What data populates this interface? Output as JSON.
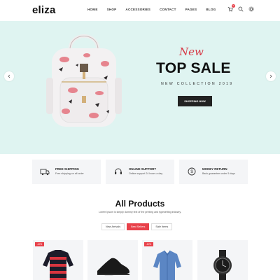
{
  "header": {
    "logo": "eliza",
    "nav": [
      "HOME",
      "SHOP",
      "ACCESSORIES",
      "CONTACT",
      "PAGES",
      "BLOG"
    ],
    "cart_count": "0"
  },
  "hero": {
    "script_text": "New",
    "title": "TOP SALE",
    "subtitle": "NEW COLLECTION 2019",
    "button_label": "SHOPPING NOW"
  },
  "features": [
    {
      "icon": "truck-icon",
      "title": "FREE SHIPPING",
      "desc": "Free shipping on all order"
    },
    {
      "icon": "headset-icon",
      "title": "ONLINE SUPPORT",
      "desc": "Online support 24 hours a day"
    },
    {
      "icon": "money-return-icon",
      "title": "MONEY RETURN",
      "desc": "Back guarantee under 5 days"
    }
  ],
  "products_section": {
    "title": "All Products",
    "subtitle": "Lorem Ipsum is simply dummy text of the printing and typesetting industry.",
    "tabs": [
      "New Arrivals",
      "Best Sellers",
      "Sale Items"
    ],
    "active_tab": "Best Sellers"
  },
  "products": [
    {
      "name": "striped-sweater",
      "badge": "-10%"
    },
    {
      "name": "black-sneaker",
      "badge": ""
    },
    {
      "name": "denim-shirt",
      "badge": "-10%"
    },
    {
      "name": "wrist-watch",
      "badge": ""
    }
  ],
  "colors": {
    "accent": "#e8414a",
    "hero_bg": "#dff4f1",
    "panel_bg": "#f4f5f7",
    "button_dark": "#222222"
  }
}
